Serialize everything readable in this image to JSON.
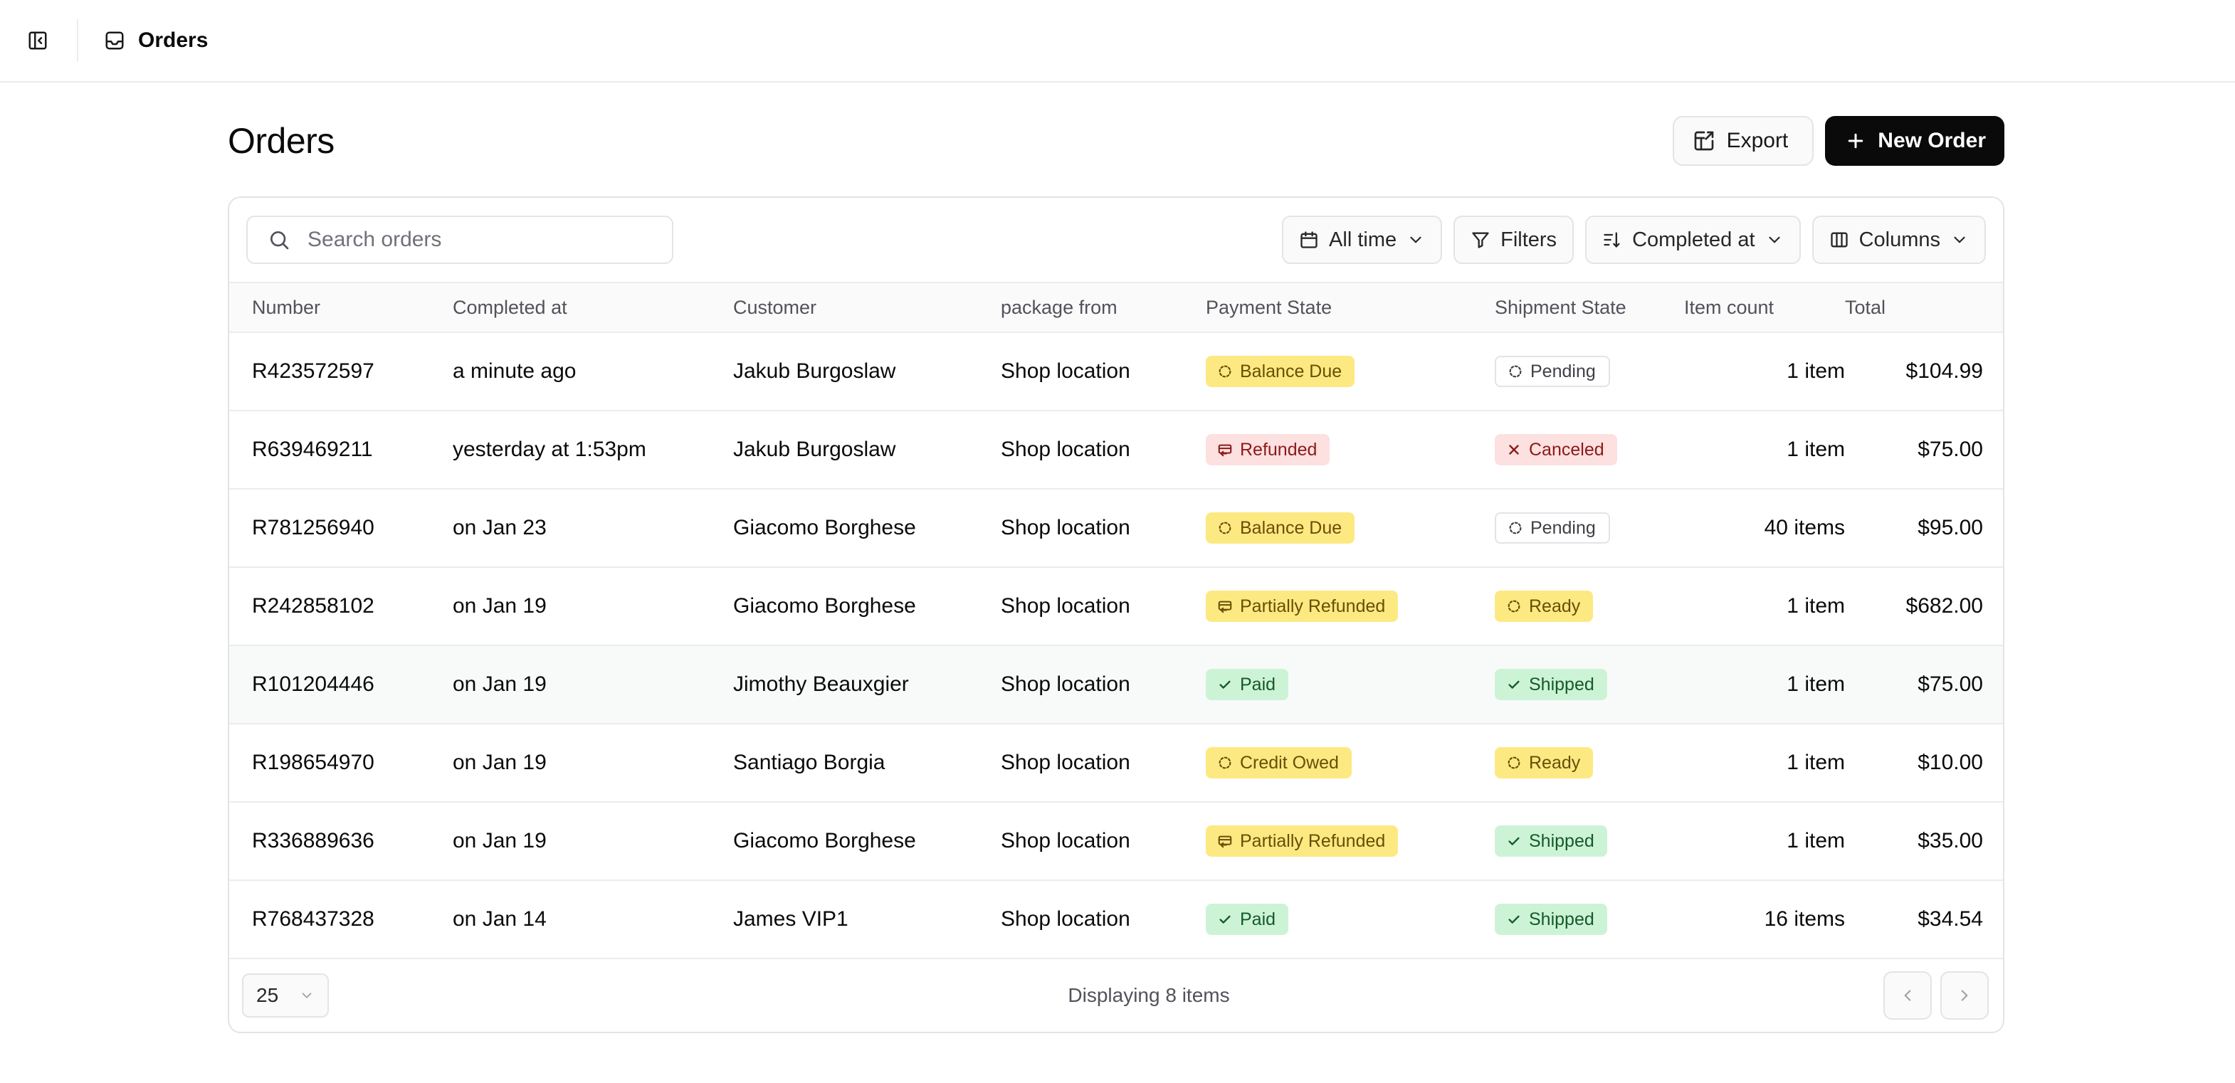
{
  "topbar": {
    "breadcrumb_title": "Orders"
  },
  "page": {
    "title": "Orders",
    "export_label": "Export",
    "new_order_label": "New Order"
  },
  "toolbar": {
    "search_placeholder": "Search orders",
    "date_range_label": "All time",
    "filters_label": "Filters",
    "sort_label": "Completed at",
    "columns_label": "Columns"
  },
  "table": {
    "headers": {
      "number": "Number",
      "completed_at": "Completed at",
      "customer": "Customer",
      "package_from": "package from",
      "payment_state": "Payment State",
      "shipment_state": "Shipment State",
      "item_count": "Item count",
      "total": "Total"
    },
    "rows": [
      {
        "number": "R423572597",
        "completed_at": "a minute ago",
        "customer": "Jakub Burgoslaw",
        "package_from": "Shop location",
        "payment_state": "Balance Due",
        "shipment_state": "Pending",
        "item_count": "1 item",
        "total": "$104.99"
      },
      {
        "number": "R639469211",
        "completed_at": "yesterday at 1:53pm",
        "customer": "Jakub Burgoslaw",
        "package_from": "Shop location",
        "payment_state": "Refunded",
        "shipment_state": "Canceled",
        "item_count": "1 item",
        "total": "$75.00"
      },
      {
        "number": "R781256940",
        "completed_at": "on Jan 23",
        "customer": "Giacomo Borghese",
        "package_from": "Shop location",
        "payment_state": "Balance Due",
        "shipment_state": "Pending",
        "item_count": "40 items",
        "total": "$95.00"
      },
      {
        "number": "R242858102",
        "completed_at": "on Jan 19",
        "customer": "Giacomo Borghese",
        "package_from": "Shop location",
        "payment_state": "Partially Refunded",
        "shipment_state": "Ready",
        "item_count": "1 item",
        "total": "$682.00"
      },
      {
        "number": "R101204446",
        "completed_at": "on Jan 19",
        "customer": "Jimothy Beauxgier",
        "package_from": "Shop location",
        "payment_state": "Paid",
        "shipment_state": "Shipped",
        "item_count": "1 item",
        "total": "$75.00"
      },
      {
        "number": "R198654970",
        "completed_at": "on Jan 19",
        "customer": "Santiago Borgia",
        "package_from": "Shop location",
        "payment_state": "Credit Owed",
        "shipment_state": "Ready",
        "item_count": "1 item",
        "total": "$10.00"
      },
      {
        "number": "R336889636",
        "completed_at": "on Jan 19",
        "customer": "Giacomo Borghese",
        "package_from": "Shop location",
        "payment_state": "Partially Refunded",
        "shipment_state": "Shipped",
        "item_count": "1 item",
        "total": "$35.00"
      },
      {
        "number": "R768437328",
        "completed_at": "on Jan 14",
        "customer": "James VIP1",
        "package_from": "Shop location",
        "payment_state": "Paid",
        "shipment_state": "Shipped",
        "item_count": "16 items",
        "total": "$34.54"
      }
    ]
  },
  "footer": {
    "page_size": "25",
    "display_count": "Displaying 8 items"
  },
  "colors": {
    "primary_button": "#0a0a0a",
    "badge_yellow": "#fde982",
    "badge_red": "#fde0e0",
    "badge_green": "#cdf3d6",
    "row_highlight": "#f8faf9"
  }
}
